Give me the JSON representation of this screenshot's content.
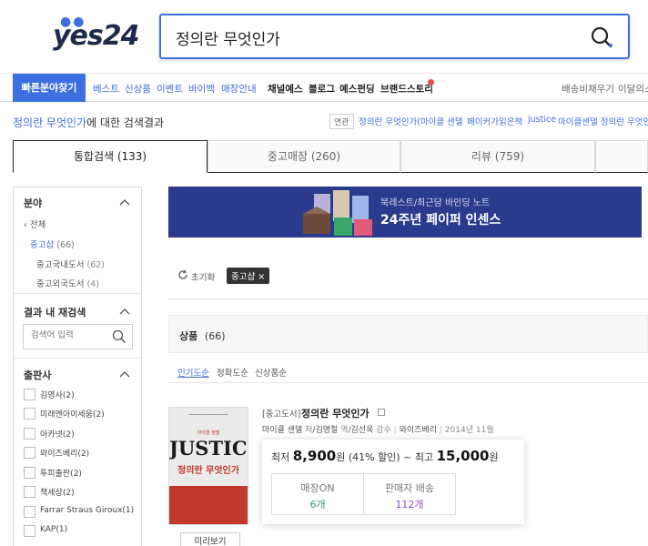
{
  "header": {
    "logo_text": "yes24",
    "search_value": "정의란 무엇인가"
  },
  "nav": {
    "quick_find": "빠른분야찾기",
    "blue_items": [
      "베스트",
      "신상품",
      "이벤트",
      "바이백",
      "매장안내"
    ],
    "dark_items": [
      "채널예스",
      "블로그",
      "예스펀딩",
      "브랜드스토리"
    ],
    "right_items": [
      "배송비채우기",
      "이달의스"
    ]
  },
  "result": {
    "keyword": "정의란 무엇인가",
    "suffix": "에 대한 검색결과",
    "related_tag": "연관",
    "related_items": [
      "정의란 무엇인가(마이클 샌델",
      "페이커가읽은책",
      "justice",
      "마이클샌델 정의란 무엇인"
    ]
  },
  "tabs": [
    {
      "label": "통합검색 (133)"
    },
    {
      "label": "중고매장 (260)"
    },
    {
      "label": "리뷰 (759)"
    }
  ],
  "sidebar": {
    "category": {
      "title": "분야",
      "all": "전체",
      "used": "중고샵",
      "used_count": "(66)",
      "domestic": "중고국내도서",
      "domestic_count": "(62)",
      "foreign": "중고외국도서",
      "foreign_count": "(4)"
    },
    "research": {
      "title": "결과 내 재검색",
      "placeholder": "검색어 입력"
    },
    "publisher": {
      "title": "출판사",
      "items": [
        {
          "name": "김영사",
          "count": "(2)"
        },
        {
          "name": "미래엔아이세움",
          "count": "(2)"
        },
        {
          "name": "아카넷",
          "count": "(2)"
        },
        {
          "name": "와이즈베리",
          "count": "(2)"
        },
        {
          "name": "투피출판",
          "count": "(2)"
        },
        {
          "name": "책세상",
          "count": "(2)"
        },
        {
          "name": "Farrar Straus Giroux",
          "count": "(1)"
        },
        {
          "name": "KAP",
          "count": "(1)"
        }
      ]
    }
  },
  "banner": {
    "line1": "북레스트/최근담 바인딩 노트",
    "line2": "24주년 페이퍼 인센스"
  },
  "filter": {
    "reset": "초기화",
    "chip": "중고샵"
  },
  "products": {
    "header_label": "상품",
    "header_count": "(66)",
    "sort_options": [
      "인기도순",
      "정확도순",
      "신상품순"
    ]
  },
  "book": {
    "category": "[중고도서]",
    "title": "정의란 무엇인가",
    "author": "마이클 샌델",
    "author_role": "저",
    "translator": "김명철",
    "translator_role": "역",
    "supervisor": "김선욱",
    "supervisor_role": "감수",
    "publisher": "와이즈베리",
    "date": "2014년 11월",
    "cover_author": "마이클 샌델",
    "cover_big": "JUSTICE",
    "cover_sub": "정의란 무엇인가",
    "preview": "미리보기",
    "price_min_label": "최저",
    "price_min": "8,900",
    "won": "원",
    "discount": "(41% 할인)",
    "tilde": "~",
    "price_max_label": "최고",
    "price_max": "15,000",
    "store_on_label": "매장ON",
    "store_on_value": "6개",
    "seller_label": "판매자 배송",
    "seller_value": "112개"
  },
  "colors": {
    "accent": "#3d6fe0",
    "store_green": "#2e9f6e",
    "seller_purple": "#8a4bd6"
  }
}
